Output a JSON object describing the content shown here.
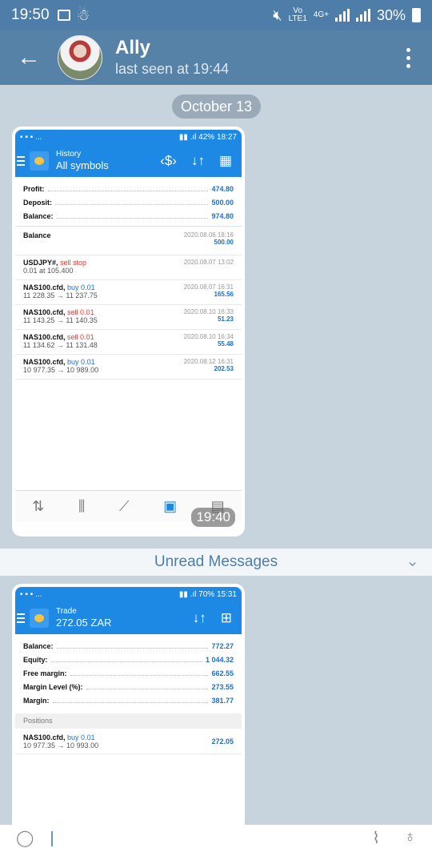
{
  "status_bar": {
    "time": "19:50",
    "network_top": "Vo",
    "network_bottom": "LTE1",
    "net_type": "4G+",
    "battery": "30%"
  },
  "chat_header": {
    "name": "Ally",
    "status": "last seen at 19:44"
  },
  "date_separator": "October 13",
  "message1": {
    "time": "19:40",
    "phone_status": {
      "battery": "42%",
      "time": "18:27"
    },
    "app_header": {
      "subtitle": "History",
      "title": "All symbols"
    },
    "summary": [
      {
        "label": "Profit:",
        "value": "474.80"
      },
      {
        "label": "Deposit:",
        "value": "500.00"
      },
      {
        "label": "Balance:",
        "value": "974.80"
      }
    ],
    "balance_entry": {
      "label": "Balance",
      "date": "2020.08.06 18:16",
      "amount": "500.00"
    },
    "deals": [
      {
        "symbol": "USDJPY#,",
        "action": "sell stop",
        "side": "sell",
        "detail": "0.01 at 105.400",
        "date": "2020.08.07 13:02",
        "amount": ""
      },
      {
        "symbol": "NAS100.cfd,",
        "action": "buy 0.01",
        "side": "buy",
        "detail": "11 228.35 → 11 237.75",
        "date": "2020.08.07 16:31",
        "amount": "165.56"
      },
      {
        "symbol": "NAS100.cfd,",
        "action": "sell 0.01",
        "side": "sell",
        "detail": "11 143.25 → 11 140.35",
        "date": "2020.08.10 16:33",
        "amount": "51.23"
      },
      {
        "symbol": "NAS100.cfd,",
        "action": "sell 0.01",
        "side": "sell",
        "detail": "11 134.62 → 11 131.48",
        "date": "2020.08.10 16:34",
        "amount": "55.48"
      },
      {
        "symbol": "NAS100.cfd,",
        "action": "buy 0.01",
        "side": "buy",
        "detail": "10 977.35 → 10 989.00",
        "date": "2020.08.12 16:31",
        "amount": "202.53"
      }
    ]
  },
  "unread_label": "Unread Messages",
  "message2": {
    "phone_status": {
      "battery": "70%",
      "time": "15:31"
    },
    "app_header": {
      "subtitle": "Trade",
      "title": "272.05 ZAR"
    },
    "summary": [
      {
        "label": "Balance:",
        "value": "772.27"
      },
      {
        "label": "Equity:",
        "value": "1 044.32"
      },
      {
        "label": "Free margin:",
        "value": "662.55"
      },
      {
        "label": "Margin Level (%):",
        "value": "273.55"
      },
      {
        "label": "Margin:",
        "value": "381.77"
      }
    ],
    "positions_label": "Positions",
    "position": {
      "symbol": "NAS100.cfd,",
      "action": "buy 0.01",
      "detail": "10 977.35 → 10 993.00",
      "amount": "272.05"
    }
  },
  "colors": {
    "header": "#5682a7",
    "accent": "#1e88e5",
    "sell": "#e53935",
    "buy": "#1e6fc9"
  }
}
